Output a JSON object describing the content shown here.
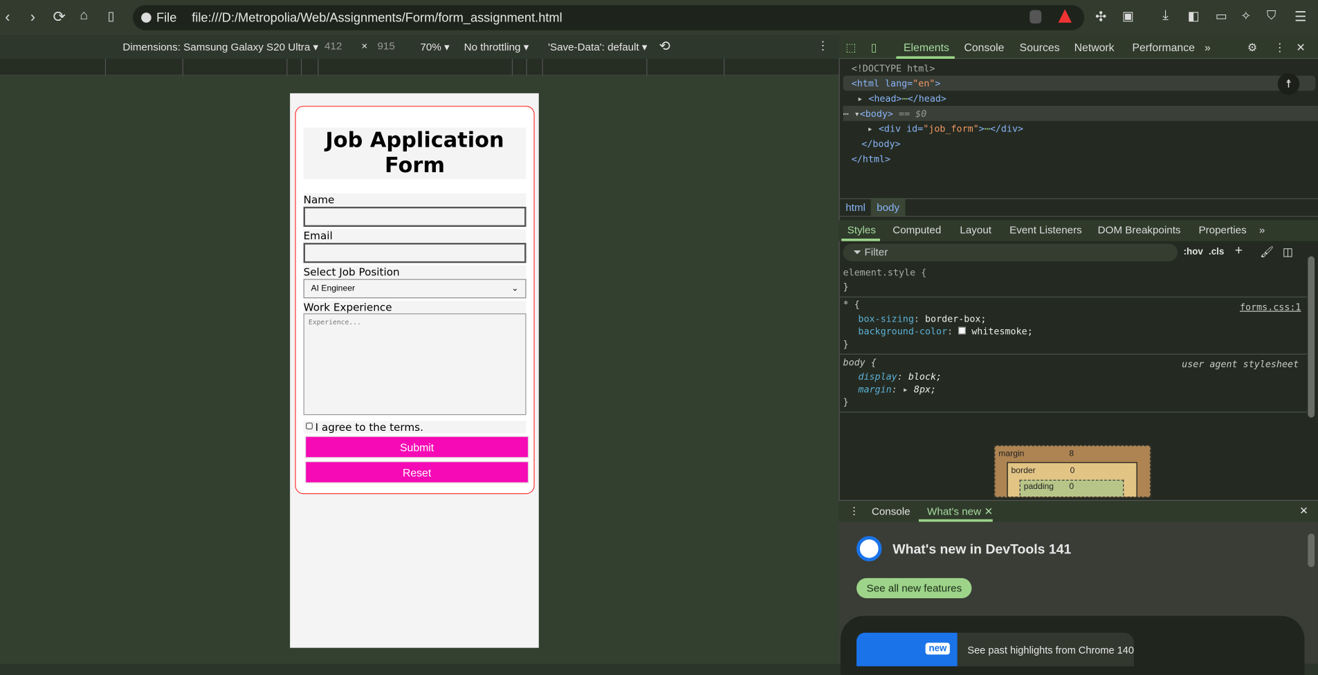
{
  "browser": {
    "file_label": "File",
    "url": "file:///D:/Metropolia/Web/Assignments/Form/form_assignment.html"
  },
  "device_toolbar": {
    "dimensions": "Dimensions: Samsung Galaxy S20 Ultra ▾",
    "width": "412",
    "x": "×",
    "height": "915",
    "zoom": "70% ▾",
    "throttling": "No throttling ▾",
    "save_data": "'Save-Data': default ▾"
  },
  "form": {
    "title": "Job Application Form",
    "name_label": "Name",
    "email_label": "Email",
    "position_label": "Select Job Position",
    "position_value": "AI Engineer",
    "experience_label": "Work Experience",
    "experience_placeholder": "Experience...",
    "terms_label": "I agree to the terms.",
    "submit": "Submit",
    "reset": "Reset",
    "accent_color": "#f50ab5",
    "border_color": "#ff3333"
  },
  "devtools": {
    "tabs": [
      "Elements",
      "Console",
      "Sources",
      "Network",
      "Performance"
    ],
    "active_tab": "Elements",
    "dom": {
      "doctype": "<!DOCTYPE html>",
      "html_open": "<html",
      "lang_attr": " lang=",
      "lang_val": "\"en\"",
      "gt": ">",
      "head": "<head>",
      "head_close": "</head>",
      "body": "<body>",
      "body_sel": " == $0",
      "div_open": "<div",
      "id_attr": " id=",
      "id_val": "\"job_form\"",
      "div_close": "</div>",
      "body_close": "</body>",
      "html_close": "</html>"
    },
    "breadcrumbs": [
      "html",
      "body"
    ],
    "style_tabs": [
      "Styles",
      "Computed",
      "Layout",
      "Event Listeners",
      "DOM Breakpoints",
      "Properties"
    ],
    "filter_placeholder": "Filter",
    "hov": ":hov",
    "cls": ".cls",
    "rules": {
      "element_style": "element.style {",
      "close": "}",
      "star": "* {",
      "star_src": "forms.css:1",
      "box_sizing_prop": "box-sizing",
      "box_sizing_val": "border-box;",
      "bg_prop": "background-color",
      "bg_val": "whitesmoke;",
      "body": "body {",
      "body_src": "user agent stylesheet",
      "display_prop": "display",
      "display_val": "block;",
      "margin_prop": "margin",
      "margin_val": "8px;"
    },
    "box_model": {
      "margin_label": "margin",
      "margin": "8",
      "border_label": "border",
      "border": "0",
      "padding_label": "padding",
      "padding": "0"
    },
    "drawer": {
      "tabs": [
        "Console",
        "What's new"
      ],
      "heading": "What's new in DevTools 141",
      "button": "See all new features",
      "badge": "new",
      "highlight": "See past highlights from Chrome 140"
    }
  }
}
